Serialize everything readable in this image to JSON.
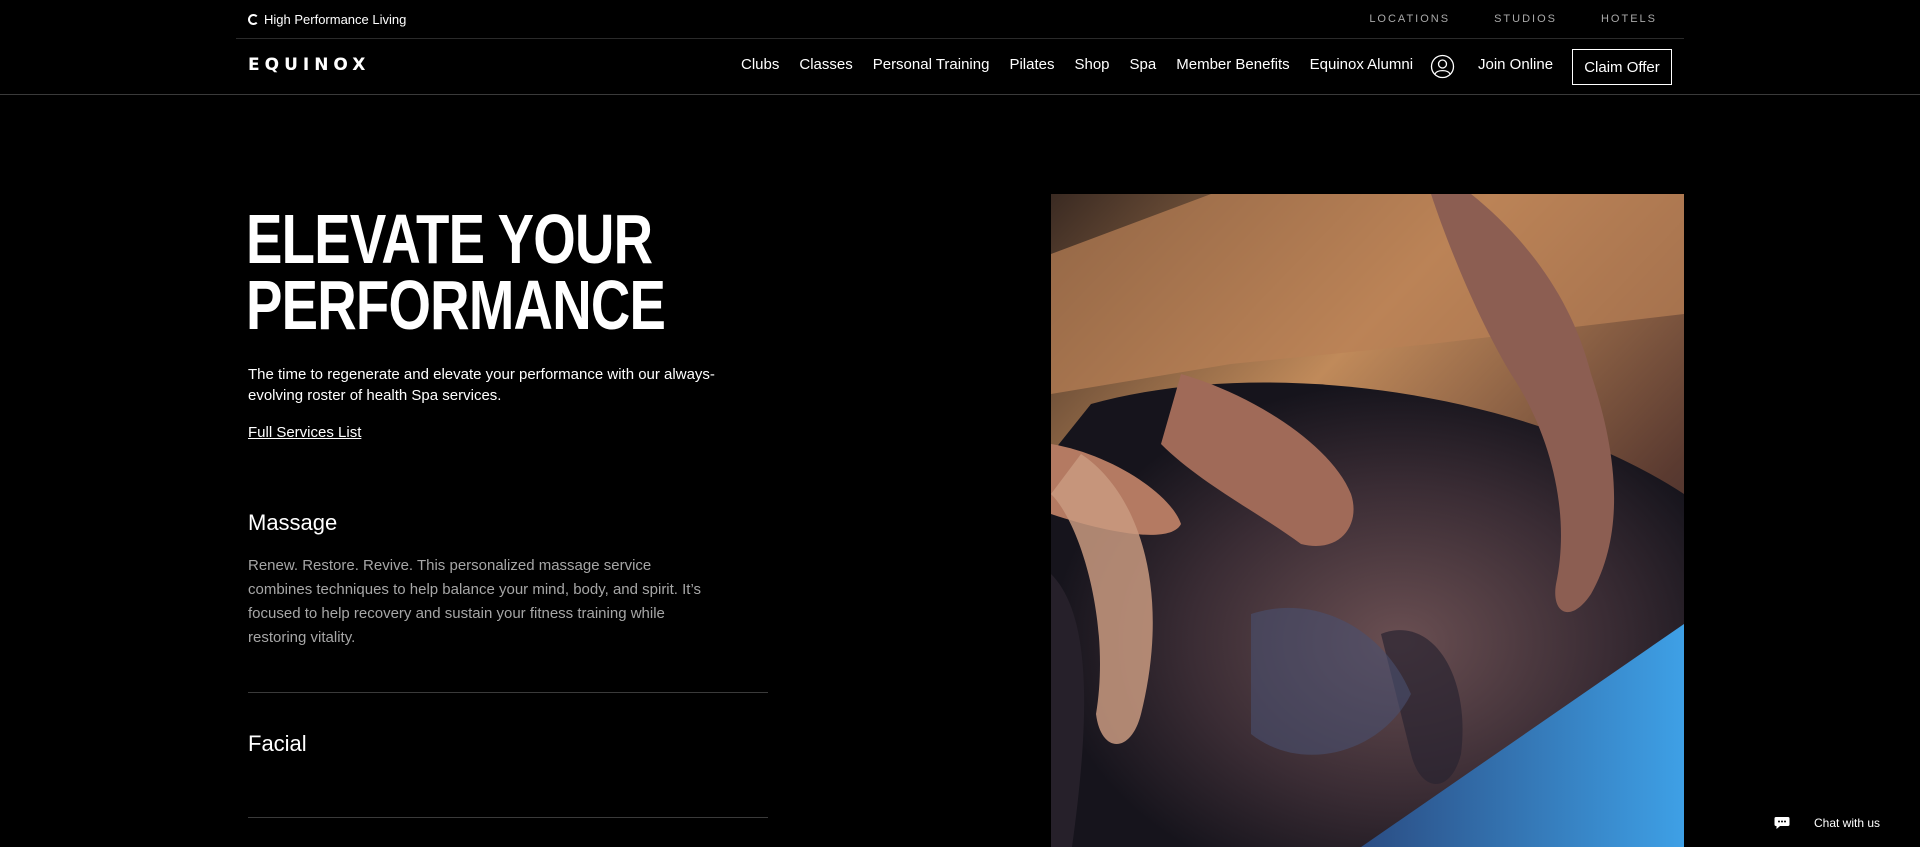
{
  "utility": {
    "brand_label": "High Performance Living",
    "links": [
      "LOCATIONS",
      "STUDIOS",
      "HOTELS"
    ]
  },
  "header": {
    "logo": "EQUINOX",
    "nav": [
      "Clubs",
      "Classes",
      "Personal Training",
      "Pilates",
      "Shop",
      "Spa",
      "Member Benefits",
      "Equinox Alumni"
    ],
    "join_label": "Join Online",
    "claim_label": "Claim Offer"
  },
  "hero": {
    "title_line1": "ELEVATE YOUR",
    "title_line2": "PERFORMANCE",
    "description": "The time to regenerate and elevate your performance with our always-evolving roster of health Spa services.",
    "link": "Full Services List"
  },
  "services": [
    {
      "title": "Massage",
      "description": "Renew. Restore. Revive. This personalized massage service combines techniques to help balance your mind, body, and spirit. It’s focused to help recovery and sustain your fitness training while restoring vitality."
    },
    {
      "title": "Facial"
    }
  ],
  "chat": {
    "label": "Chat with us"
  }
}
